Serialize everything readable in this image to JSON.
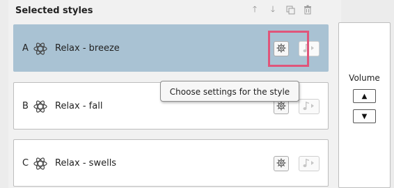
{
  "header": {
    "title": "Selected styles",
    "toolbar_icons": [
      "move-up-icon",
      "move-down-icon",
      "duplicate-icon",
      "delete-icon"
    ]
  },
  "styles": [
    {
      "letter": "A",
      "label": "Relax - breeze",
      "selected": true
    },
    {
      "letter": "B",
      "label": "Relax - fall",
      "selected": false
    },
    {
      "letter": "C",
      "label": "Relax - swells",
      "selected": false
    }
  ],
  "tooltip": {
    "text": "Choose settings for the style"
  },
  "volume": {
    "label": "Volume",
    "up_glyph": "▲",
    "down_glyph": "▼"
  },
  "colors": {
    "selected_row": "#a9c2d3",
    "highlight_box": "#e0557a",
    "background": "#f1f1f1"
  }
}
